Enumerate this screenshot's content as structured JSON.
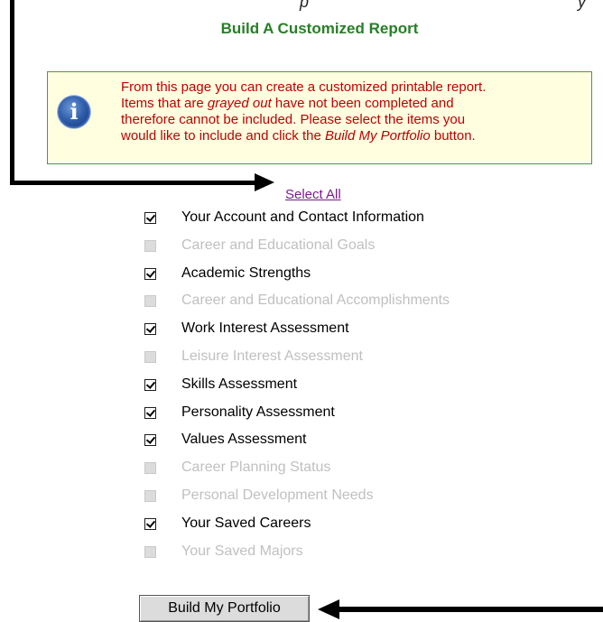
{
  "top_text": {
    "fragment_left": "p",
    "fragment_right": "y"
  },
  "page_title": "Build A Customized Report",
  "info": {
    "icon": "info-icon",
    "glyph": "i",
    "line1": "From this page you can create a customized printable report.",
    "line2_pre": "Items that are ",
    "line2_em": "grayed out",
    "line2_post": " have not been completed and",
    "line3": "therefore cannot be included. Please select the items you",
    "line4_pre": "would like to include and click the ",
    "line4_em": "Build My Portfolio",
    "line4_post": " button."
  },
  "select_all": "Select All",
  "items": [
    {
      "label": "Your Account and Contact Information",
      "checked": true,
      "enabled": true
    },
    {
      "label": "Career and Educational Goals",
      "checked": false,
      "enabled": false
    },
    {
      "label": "Academic Strengths",
      "checked": true,
      "enabled": true
    },
    {
      "label": "Career and Educational Accomplishments",
      "checked": false,
      "enabled": false
    },
    {
      "label": "Work Interest Assessment",
      "checked": true,
      "enabled": true
    },
    {
      "label": "Leisure Interest Assessment",
      "checked": false,
      "enabled": false
    },
    {
      "label": "Skills Assessment",
      "checked": true,
      "enabled": true
    },
    {
      "label": "Personality Assessment",
      "checked": true,
      "enabled": true
    },
    {
      "label": "Values Assessment",
      "checked": true,
      "enabled": true
    },
    {
      "label": "Career Planning Status",
      "checked": false,
      "enabled": false
    },
    {
      "label": "Personal Development Needs",
      "checked": false,
      "enabled": false
    },
    {
      "label": "Your Saved Careers",
      "checked": true,
      "enabled": true
    },
    {
      "label": "Your Saved Majors",
      "checked": false,
      "enabled": false
    }
  ],
  "build_button": "Build My Portfolio",
  "colors": {
    "title": "#267f26",
    "info_text": "#c00000",
    "info_bg": "#ffffe0",
    "link": "#7a1b8c",
    "disabled_text": "#c0c0c0"
  }
}
